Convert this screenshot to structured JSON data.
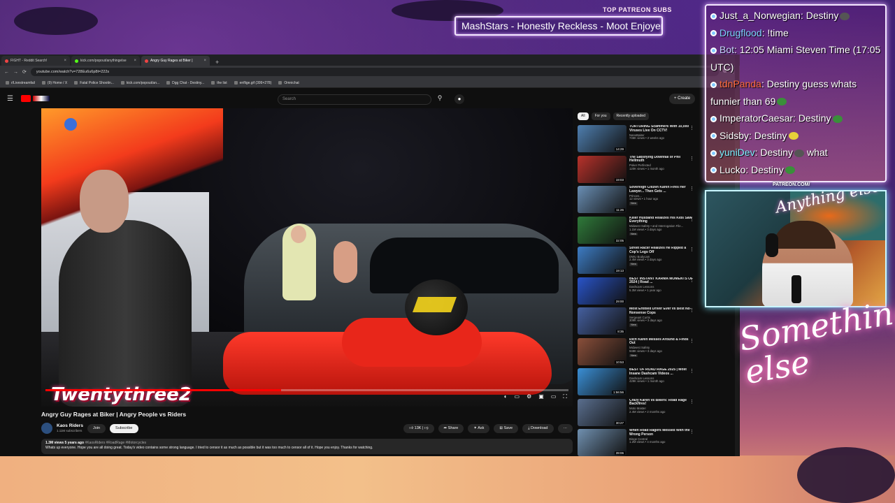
{
  "overlay": {
    "patreon_heading": "TOP PATREON SUBS",
    "patreon_ticker": "MashStars - Honestly Reckless - Moot Enjoyer",
    "patreon_url": "PATREON.COM/",
    "cam_logo": "Anything else",
    "signature": "Something else"
  },
  "browser": {
    "tabs": [
      {
        "label": "FIGHT - Reddit Search!",
        "favicon": "reddit-icon"
      },
      {
        "label": "kick.com/popout/anythingelse",
        "favicon": "kick-icon"
      },
      {
        "label": "Angry Guy Rages at Biker |",
        "favicon": "youtube-icon"
      }
    ],
    "new_tab": "+",
    "url": "youtube.com/watch?v=728Eu6u6p8t=222s",
    "bookmarks": [
      "r/Livestreamfail",
      "(9) Home / X",
      "Fatal Police Shootin...",
      "kick.com/popout/an...",
      "Dgg Chat - Destiny...",
      "the list",
      "enflige.gif (399×278)",
      "Omnichat"
    ]
  },
  "youtube": {
    "search_placeholder": "Search",
    "create_label": "+ Create",
    "video": {
      "watermark": "Twentythree2",
      "progress": 0.45,
      "title": "Angry Guy Rages at Biker | Angry People vs Riders",
      "channel": "Kaos Riders",
      "subscribers": "1.11M subscribers",
      "join": "Join",
      "subscribe": "Subscribe",
      "likes": "13K",
      "share": "Share",
      "ask": "Ask",
      "save": "Save",
      "download": "Download",
      "more": "···",
      "desc_stats": "1.3M views  5 years ago",
      "desc_tags": "#KaosRiders #RoadRage #Motorcycles",
      "desc_text": "Whats up everyone. Hope you are all doing great. Today's video contains some strong language. I tried to censor it as much as possible but it was too much to censor all of it. Hope you enjoy. Thanks for watching."
    },
    "chips": [
      "All",
      "For you",
      "Recently uploaded"
    ],
    "recommendations": [
      {
        "title": "TORTURING Scammers With 10,000 Viruses Live On CCTV!",
        "channel": "NanoBaiter",
        "views": "746K views • 2 weeks ago",
        "duration": "14:29",
        "badge": "",
        "color": "#4f7fb0"
      },
      {
        "title": "The Satisfying Downfall of Phil Hellmuth",
        "channel": "Poker Perfected",
        "views": "120K views • 1 month ago",
        "duration": "19:03",
        "badge": "",
        "color": "#b8322b"
      },
      {
        "title": "Sovereign Citizen Karen Fires Her Lawyer... Then Gets ...",
        "channel": "Princes...",
        "views": "12 views • 1 hour ago",
        "duration": "11:26",
        "badge": "New",
        "color": "#6a8fb5"
      },
      {
        "title": "Killer Husband Realizes His Kids Saw Everything",
        "channel": "Midwest Safety • and Interrogation File...",
        "views": "1.1M views • 3 days ago",
        "duration": "32:05",
        "badge": "New",
        "color": "#2f7a3a"
      },
      {
        "title": "Street Racer Realizes He Ripped a Cop's Legs Off",
        "channel": "DWU Bodycam",
        "views": "2.4M views • 3 days ago",
        "duration": "19:13",
        "badge": "New",
        "color": "#3d7cc4"
      },
      {
        "title": "BEST INSTANT KARMA MOMENTS OF 2024 | Road ...",
        "channel": "Dashcam Lessons",
        "views": "5.3M views • 1 year ago",
        "duration": "29:00",
        "badge": "",
        "color": "#2954c9"
      },
      {
        "title": "Most Entitled Driver Ever vs Best No-Nonsense Cops",
        "channel": "Sergeant Curtis",
        "views": "309K views • 3 days ago",
        "duration": "8:35",
        "badge": "New",
        "color": "#4560a0"
      },
      {
        "title": "Rich Karen Messes Around & Finds Out",
        "channel": "Midwest Safety",
        "views": "948K views • 3 days ago",
        "duration": "10:53",
        "badge": "New",
        "color": "#8a4f3a"
      },
      {
        "title": "BEST OF ROAD RAGE 2025 | Most Insane Dashcam Videos ...",
        "channel": "Dashcam Lessons",
        "views": "429K views • 1 month ago",
        "duration": "1:56:56",
        "badge": "",
        "color": "#3a8fd6"
      },
      {
        "title": "Crazy Karen vs Bikers: Road Rage Backfires!",
        "channel": "Moto Master",
        "views": "2.4M views • 2 months ago",
        "duration": "30:27",
        "badge": "",
        "color": "#5a6f8f"
      },
      {
        "title": "When Road Ragers Messed With the Wrong Person",
        "channel": "Binge Central",
        "views": "1.2M views • 4 months ago",
        "duration": "39:06",
        "badge": "",
        "color": "#7090b0"
      }
    ]
  },
  "chat": [
    {
      "user": "Just_a_Norwegian",
      "text": ": Destiny",
      "cls": "u1",
      "emote": "#555"
    },
    {
      "user": "Drugflood",
      "text": ": !time",
      "cls": "u2",
      "emote": ""
    },
    {
      "user": "Bot",
      "text": ": 12:05 Miami Steven Time (17:05 UTC)",
      "cls": "u3",
      "emote": ""
    },
    {
      "user": "tdnPanda",
      "text": ": Destiny guess whats funnier than 69",
      "cls": "u4",
      "emote": "#3a8f3a"
    },
    {
      "user": "ImperatorCaesar",
      "text": ": Destiny",
      "cls": "u5",
      "emote": "#3a8f3a"
    },
    {
      "user": "Sidsby",
      "text": ": Destiny",
      "cls": "u6",
      "emote": "#e6d23a"
    },
    {
      "user": "yuniDev",
      "text": ": Destiny",
      "cls": "u7",
      "emote": "#555",
      "after": " what"
    },
    {
      "user": "Lucko",
      "text": ": Destiny",
      "cls": "u8",
      "emote": "#3a8f3a"
    }
  ]
}
